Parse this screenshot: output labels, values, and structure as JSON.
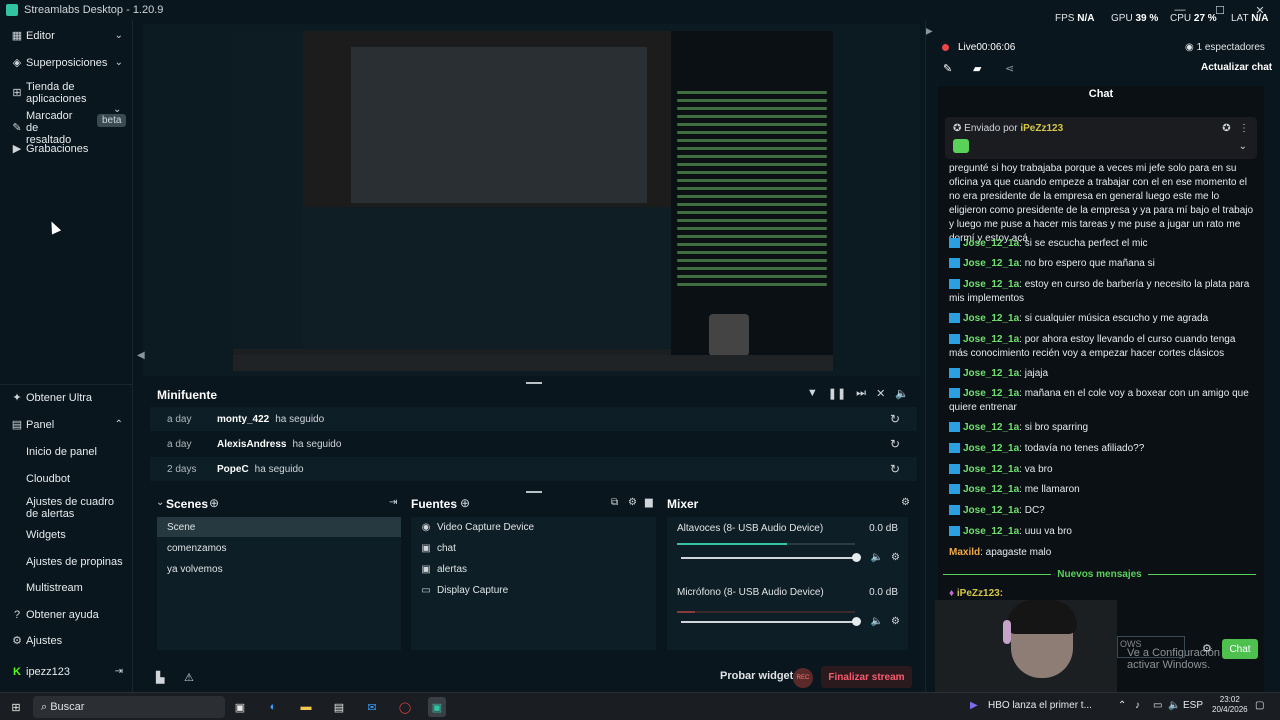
{
  "window": {
    "title": "Streamlabs Desktop - 1.20.9",
    "minimize": "—",
    "maximize": "☐",
    "close": "✕"
  },
  "sidebar": {
    "top_items": [
      {
        "label": "Editor",
        "icon": "editor-icon"
      },
      {
        "label": "Superposiciones",
        "icon": "overlays-icon"
      },
      {
        "label": "Tienda de aplicaciones",
        "icon": "app-store-icon"
      },
      {
        "label": "Marcador de resaltado",
        "icon": "highlighter-icon",
        "badge": "beta"
      },
      {
        "label": "Grabaciones",
        "icon": "recordings-icon"
      }
    ],
    "bottom_items": [
      {
        "label": "Obtener Ultra",
        "icon": "ultra-icon"
      },
      {
        "label": "Panel",
        "icon": "dashboard-icon"
      },
      {
        "label": "Inicio de panel"
      },
      {
        "label": "Cloudbot"
      },
      {
        "label": "Ajustes de cuadro de alertas"
      },
      {
        "label": "Widgets"
      },
      {
        "label": "Ajustes de propinas"
      },
      {
        "label": "Multistream"
      },
      {
        "label": "Obtener ayuda",
        "icon": "help-icon"
      },
      {
        "label": "Ajustes",
        "icon": "settings-icon"
      },
      {
        "label": "ipezz123",
        "icon": "kick-icon"
      }
    ]
  },
  "minifeed": {
    "title": "Minifuente",
    "rows": [
      {
        "ago": "a day",
        "name": "monty_422",
        "action": "ha seguido"
      },
      {
        "ago": "a day",
        "name": "AlexisAndress",
        "action": "ha seguido"
      },
      {
        "ago": "2 days",
        "name": "PopeC",
        "action": "ha seguido"
      }
    ]
  },
  "scenes": {
    "title": "Scenes",
    "items": [
      "Scene",
      "comenzamos",
      "ya volvemos"
    ],
    "selected": "Scene"
  },
  "sources": {
    "title": "Fuentes",
    "items": [
      {
        "label": "Video Capture Device",
        "icon": "camera-icon"
      },
      {
        "label": "chat",
        "icon": "browser-icon"
      },
      {
        "label": "alertas",
        "icon": "browser-icon"
      },
      {
        "label": "Display Capture",
        "icon": "display-icon"
      }
    ]
  },
  "mixer": {
    "title": "Mixer",
    "channels": [
      {
        "label": "Altavoces (8- USB Audio Device)",
        "db": "0.0 dB",
        "level": 0.62,
        "peak": 0.1
      },
      {
        "label": "Micrófono (8- USB Audio Device)",
        "db": "0.0 dB",
        "level": 0.0,
        "peak": 0.1
      }
    ]
  },
  "footer": {
    "test_widgets": "Probar widgets",
    "end_stream": "Finalizar stream",
    "rec_label": "REC"
  },
  "stats": {
    "fps_label": "FPS",
    "fps": "N/A",
    "gpu_label": "GPU",
    "gpu": "39 %",
    "cpu_label": "CPU",
    "cpu": "27 %",
    "lat_label": "LAT",
    "lat": "N/A"
  },
  "live": {
    "status": "Live",
    "time": "00:06:06",
    "viewers": "1 espectadores",
    "refresh_chat": "Actualizar chat"
  },
  "chat": {
    "title": "Chat",
    "pinned": {
      "prefix": "Enviado por",
      "user": "iPeZz123"
    },
    "messages": [
      {
        "user": "",
        "text": "pregunté si hoy trabajaba porque a veces mi jefe solo para en su oficina ya que cuando empeze a trabajar con el en ese momento el no era presidente de la empresa en general luego este me lo eligieron como presidente de la empresa y ya para mí bajo el trabajo y luego me puse a hacer mis tareas y me puse a jugar un rato me dormí y estoy acá"
      },
      {
        "user": "Jose_12_1a",
        "text": ": si se escucha perfect el mic"
      },
      {
        "user": "Jose_12_1a",
        "text": ": no bro espero que mañana si"
      },
      {
        "user": "Jose_12_1a",
        "text": ": estoy en curso de barbería y necesito la plata para mis implementos"
      },
      {
        "user": "Jose_12_1a",
        "text": ": si cualquier música escucho y me agrada"
      },
      {
        "user": "Jose_12_1a",
        "text": ": por ahora estoy llevando el curso cuando tenga más conocimiento recién voy a empezar hacer cortes clásicos"
      },
      {
        "user": "Jose_12_1a",
        "text": ": jajaja"
      },
      {
        "user": "Jose_12_1a",
        "text": ": mañana en el cole voy a boxear con un amigo que quiere entrenar"
      },
      {
        "user": "Jose_12_1a",
        "text": ": si bro sparring"
      },
      {
        "user": "Jose_12_1a",
        "text": ": todavía no tenes afiliado??"
      },
      {
        "user": "Jose_12_1a",
        "text": ": va bro"
      },
      {
        "user": "Jose_12_1a",
        "text": ": me llamaron"
      },
      {
        "user": "Jose_12_1a",
        "text": ": DC?"
      },
      {
        "user": "Jose_12_1a",
        "text": ": uuu va bro"
      },
      {
        "user": "Maxild",
        "text": ": apagaste malo"
      }
    ],
    "new_messages": "Nuevos mensajes",
    "last_user": "iPeZz123:",
    "send": "Chat",
    "input_partial": "OWS"
  },
  "watermark": "Ve a Configuración para activar Windows.",
  "taskbar": {
    "search": "Buscar",
    "news": "HBO lanza el primer t...",
    "lang": "ESP",
    "time": "23:02",
    "date": "20/4/2026"
  }
}
